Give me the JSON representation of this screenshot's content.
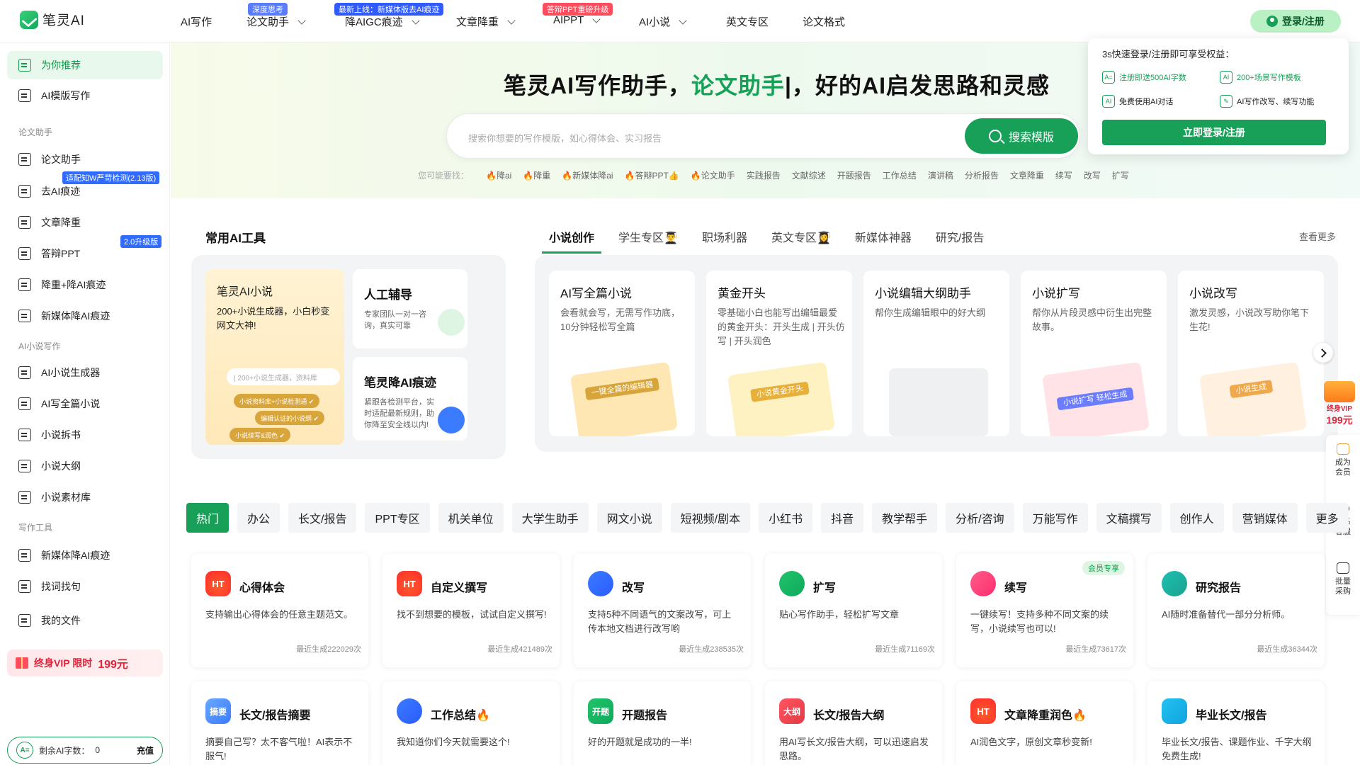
{
  "app": {
    "logo_text": "笔灵AI"
  },
  "nav": {
    "items": [
      "AI写作",
      "论文助手",
      "降AIGC痕迹",
      "文章降重",
      "AIPPT",
      "AI小说",
      "英文专区",
      "论文格式"
    ],
    "badges": {
      "thesis": "深度思考",
      "aigc": "最新上线：新媒体版去AI痕迹",
      "ppt": "答辩PPT重磅升级"
    },
    "login_label": "登录/注册"
  },
  "sidebar": {
    "items": [
      "为你推荐",
      "AI模版写作",
      "论文助手",
      "去AI痕迹",
      "文章降重",
      "答辩PPT",
      "降重+降AI痕迹",
      "新媒体降AI痕迹",
      "AI小说生成器",
      "AI写全篇小说",
      "小说拆书",
      "小说大纲",
      "小说素材库",
      "新媒体降AI痕迹",
      "找词找句",
      "我的文件"
    ],
    "sections": [
      "论文助手",
      "AI小说写作",
      "写作工具"
    ],
    "tags": [
      "适配知W严苛检测(2.13版)",
      "2.0升级版"
    ],
    "vip_label": "终身VIP 限时",
    "vip_price": "199元",
    "words_label": "剩余AI字数：",
    "words_value": "0",
    "recharge_label": "充值"
  },
  "hero": {
    "title_a": "笔灵AI写作助手，",
    "title_b": "论文助手",
    "title_c": "|，好的AI启发思路和灵感",
    "search_placeholder": "搜索你想要的写作模版，如心得体会、实习报告",
    "search_button": "搜索模版",
    "suggest_label": "您可能要找：",
    "suggestions": [
      "🔥降ai",
      "🔥降重",
      "🔥新媒体降ai",
      "🔥答辩PPT👍",
      "🔥论文助手",
      "实践报告",
      "文献综述",
      "开题报告",
      "工作总结",
      "演讲稿",
      "分析报告",
      "文章降重",
      "续写",
      "改写",
      "扩写"
    ]
  },
  "popup": {
    "title": "3s快速登录/注册即可享受权益：",
    "perks": [
      "注册即送500AI字数",
      "200+场景写作模板",
      "免费使用AI对话",
      "AI写作改写、续写功能"
    ],
    "button": "立即登录/注册"
  },
  "tools": {
    "title": "常用AI工具",
    "tabs": [
      "小说创作",
      "学生专区👨‍🎓",
      "职场利器",
      "英文专区👩‍🎓",
      "新媒体神器",
      "研究/报告"
    ],
    "see_more": "查看更多",
    "left_big": {
      "title": "笔灵AI小说",
      "desc": "200+小说生成器，小白秒变网文大神!",
      "search_hint": "| 200+小说生成器，资料库",
      "chips": [
        "小说资料库+小说检测通 ✔",
        "编辑认证的小说纲 ✔",
        "小说续写&润色 ✔"
      ]
    },
    "left_small": [
      {
        "title": "人工辅导",
        "desc": "专家团队一对一咨询，真实可靠"
      },
      {
        "title": "笔灵降AI痕迹",
        "desc": "紧跟各检测平台，实时适配最新规则，助你降至安全线以内!"
      }
    ],
    "cards": [
      {
        "title": "AI写全篇小说",
        "desc": "会看就会写，无需写作功底，10分钟轻松写全篇",
        "art": "一键全篇的编辑器"
      },
      {
        "title": "黄金开头",
        "desc": "零基础小白也能写出编辑最爱的黄金开头：开头生成 | 开头仿写 | 开头润色",
        "art": "小说黄金开头"
      },
      {
        "title": "小说编辑大纲助手",
        "desc": "帮你生成编辑眼中的好大纲",
        "art": ""
      },
      {
        "title": "小说扩写",
        "desc": "帮你从片段灵感中衍生出完整故事。",
        "art": "小说扩写 轻松生成"
      },
      {
        "title": "小说改写",
        "desc": "激发灵感，小说改写助你笔下生花!",
        "art": "小说生成"
      }
    ]
  },
  "float": {
    "vip_label": "终身VIP",
    "vip_price": "199元",
    "items": [
      "成为会员",
      "联系客服",
      "批量采购"
    ]
  },
  "categories": [
    "热门",
    "办公",
    "长文/报告",
    "PPT专区",
    "机关单位",
    "大学生助手",
    "网文小说",
    "短视频/剧本",
    "小红书",
    "抖音",
    "教学帮手",
    "分析/咨询",
    "万能写作",
    "文稿撰写",
    "创作人",
    "营销媒体",
    "更多"
  ],
  "templates": [
    {
      "title": "心得体会",
      "desc": "支持输出心得体会的任意主题范文。",
      "count": "最近生成222029次",
      "icon": "HT"
    },
    {
      "title": "自定义撰写",
      "desc": "找不到想要的模板，试试自定义撰写!",
      "count": "最近生成421489次",
      "icon": "HT"
    },
    {
      "title": "改写",
      "desc": "支持5种不同语气的文案改写，可上传本地文档进行改写哟",
      "count": "最近生成238535次",
      "icon": ""
    },
    {
      "title": "扩写",
      "desc": "贴心写作助手，轻松扩写文章",
      "count": "最近生成71169次",
      "icon": ""
    },
    {
      "title": "续写",
      "desc": "一键续写！支持多种不同文案的续写，小说续写也可以!",
      "count": "最近生成73617次",
      "icon": "",
      "tag": "会员专享"
    },
    {
      "title": "研究报告",
      "desc": "AI随时准备替代一部分分析师。",
      "count": "最近生成36344次",
      "icon": ""
    },
    {
      "title": "长文/报告摘要",
      "desc": "摘要自己写？太不客气啦！AI表示不服气!",
      "count": "",
      "icon": "摘要"
    },
    {
      "title": "工作总结🔥",
      "desc": "我知道你们今天就需要这个!",
      "count": "",
      "icon": ""
    },
    {
      "title": "开题报告",
      "desc": "好的开题就是成功的一半!",
      "count": "",
      "icon": "开题"
    },
    {
      "title": "长文/报告大纲",
      "desc": "用AI写长文/报告大纲，可以迅速启发思路。",
      "count": "",
      "icon": "大纲"
    },
    {
      "title": "文章降重润色🔥",
      "desc": "AI润色文字，原创文章秒变新!",
      "count": "",
      "icon": "HT"
    },
    {
      "title": "毕业长文/报告",
      "desc": "毕业长文/报告、课题作业、千字大纲免费生成!",
      "count": "",
      "icon": ""
    }
  ],
  "colors": {
    "brand": "#18a058",
    "vip": "#e0243a",
    "tag_blue": "#2f6bff"
  }
}
